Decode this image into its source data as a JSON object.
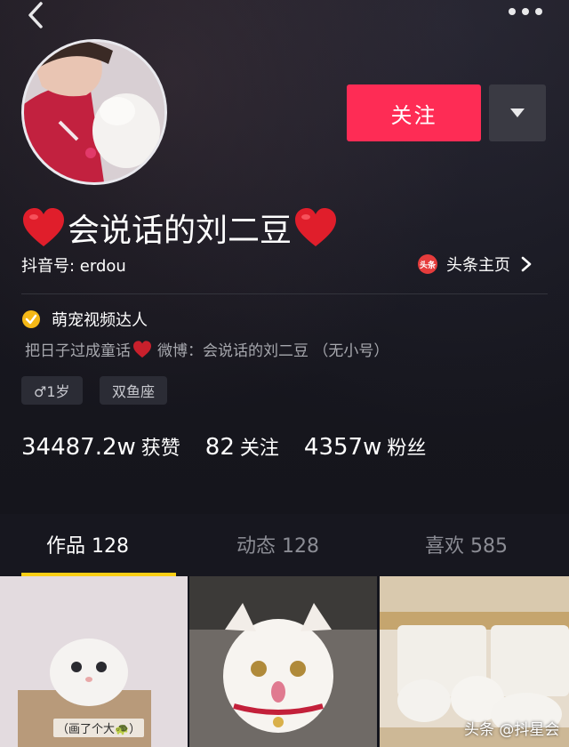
{
  "header": {
    "back_icon": "chevron-left-icon",
    "more_icon": "more-dots-icon"
  },
  "profile": {
    "avatar_icon": "avatar",
    "follow_label": "关注",
    "dropdown_icon": "triangle-down-icon",
    "nickname": "会说话的刘二豆",
    "nickname_decoration": "heart-emoji",
    "douyin_id": "抖音号: erdou",
    "toutiao_logo_text": "头条",
    "toutiao_label": "头条主页",
    "verified_title": "萌宠视频达人",
    "bio_left": "把日子过成童话",
    "bio_right": "微博：会说话的刘二豆 （无小号）",
    "tags": [
      "♂1岁",
      "双鱼座"
    ]
  },
  "stats": [
    {
      "value": "34487.2w",
      "label": "获赞"
    },
    {
      "value": "82",
      "label": "关注"
    },
    {
      "value": "4357w",
      "label": "粉丝"
    }
  ],
  "tabs": [
    {
      "label": "作品 128",
      "active": true
    },
    {
      "label": "动态 128",
      "active": false
    },
    {
      "label": "喜欢 585",
      "active": false
    }
  ],
  "grid": {
    "items": [
      {
        "caption": "（画了个大🐢）"
      },
      {
        "caption": ""
      },
      {
        "caption": ""
      }
    ]
  },
  "watermark": "头条 @抖星会",
  "colors": {
    "background": "#14151d",
    "accent": "#fe2c55",
    "tab_underline": "#face15",
    "verify_badge": "#f5b817"
  }
}
